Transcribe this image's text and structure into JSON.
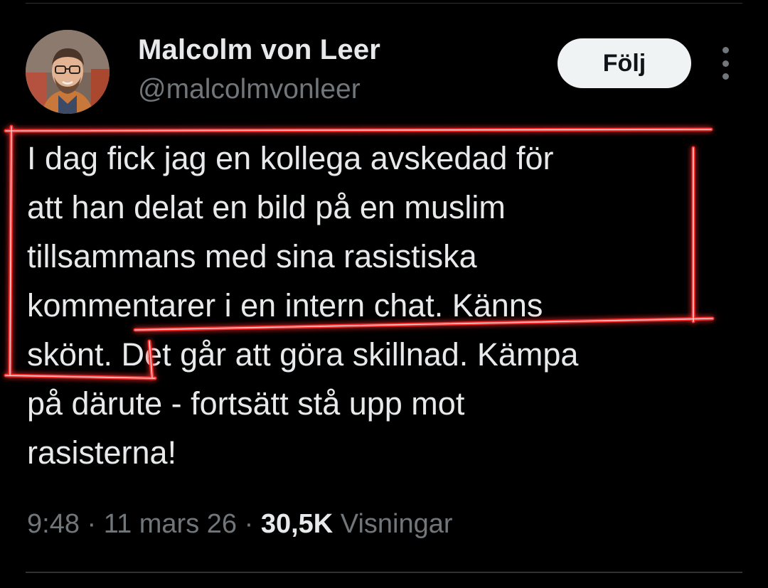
{
  "author": {
    "display_name": "Malcolm von Leer",
    "handle": "@malcolmvonleer",
    "avatar_icon": "profile-photo"
  },
  "actions": {
    "follow_label": "Följ",
    "more_icon": "vertical-ellipsis-icon"
  },
  "tweet": {
    "lines": [
      "I dag fick jag en kollega avskedad för",
      "att han delat en bild på en muslim",
      "tillsammans med sina rasistiska",
      "kommentarer i en intern chat. Känns",
      "skönt. Det går att göra skillnad. Kämpa",
      "på därute - fortsätt stå upp mot",
      "rasisterna!"
    ]
  },
  "meta": {
    "time": "9:48",
    "separator": "·",
    "date": "11 mars 26",
    "views_count": "30,5K",
    "views_label": "Visningar"
  },
  "colors": {
    "background": "#000000",
    "text": "#e7e9ea",
    "secondary_text": "#71767b",
    "follow_button_bg": "#eff3f4",
    "highlight_stroke": "#ff2a2a"
  }
}
